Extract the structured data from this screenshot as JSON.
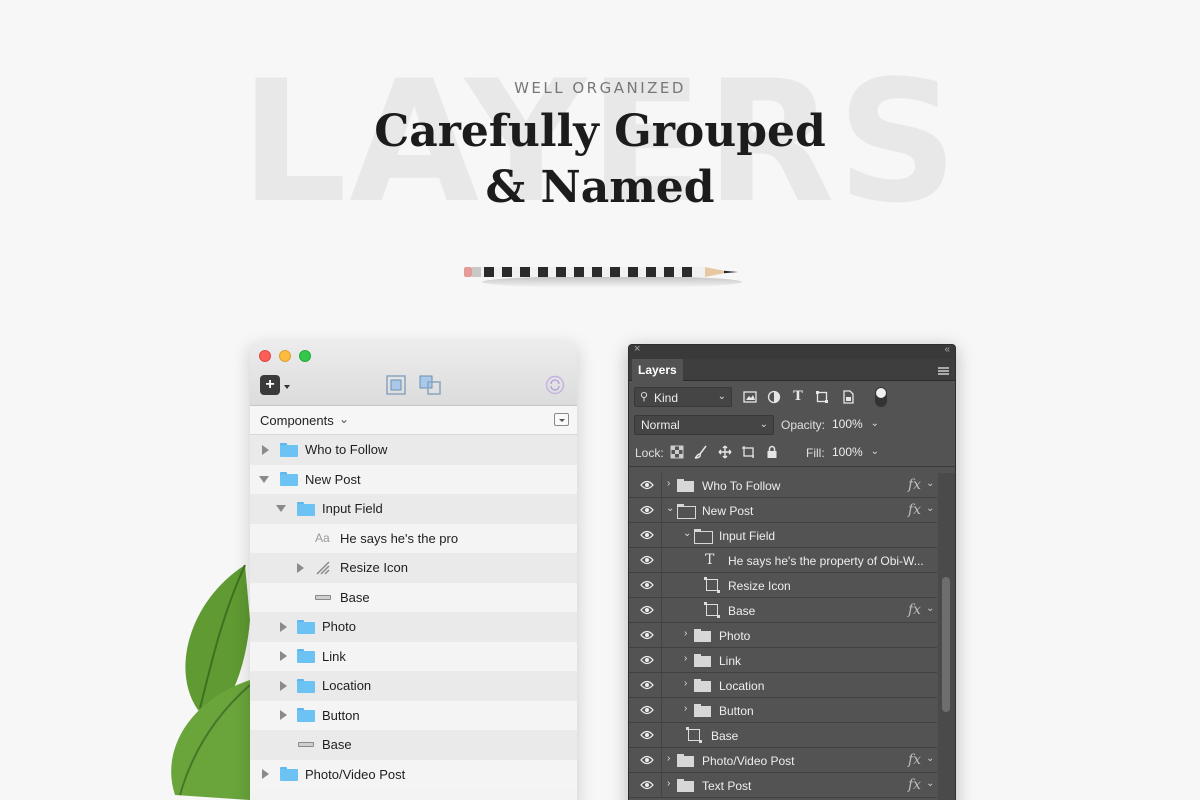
{
  "hero": {
    "background_word": "LAYERS",
    "eyebrow": "WELL ORGANIZED",
    "headline_line1": "Carefully Grouped",
    "headline_line2": "& Named"
  },
  "colors": {
    "background": "#f7f7f7",
    "sketch_folder": "#6cc3f3",
    "ps_panel": "#535353",
    "traffic_red": "#fc5f58",
    "traffic_yellow": "#fdbc40",
    "traffic_green": "#34c84a"
  },
  "sketch": {
    "toolbar": {
      "add_icon": "plus-icon",
      "tool1_icon": "group-icon",
      "tool2_icon": "ungroup-icon",
      "sync_icon": "sync-icon"
    },
    "page_selector": "Components",
    "layers": [
      {
        "label": "Who to Follow",
        "type": "folder",
        "state": "collapsed"
      },
      {
        "label": "New Post",
        "type": "folder",
        "state": "expanded"
      },
      {
        "label": "Input Field",
        "type": "folder",
        "state": "expanded"
      },
      {
        "label": "He says he's the pro",
        "type": "text",
        "icon_text": "Aa"
      },
      {
        "label": "Resize Icon",
        "type": "shape",
        "state": "collapsed"
      },
      {
        "label": "Base",
        "type": "rect"
      },
      {
        "label": "Photo",
        "type": "folder",
        "state": "collapsed"
      },
      {
        "label": "Link",
        "type": "folder",
        "state": "collapsed"
      },
      {
        "label": "Location",
        "type": "folder",
        "state": "collapsed"
      },
      {
        "label": "Button",
        "type": "folder",
        "state": "collapsed"
      },
      {
        "label": "Base",
        "type": "rect"
      },
      {
        "label": "Photo/Video Post",
        "type": "folder",
        "state": "collapsed"
      }
    ]
  },
  "photoshop": {
    "tab": "Layers",
    "filter_kind": "Kind",
    "blend_mode": "Normal",
    "opacity_label": "Opacity:",
    "opacity_value": "100%",
    "lock_label": "Lock:",
    "fill_label": "Fill:",
    "fill_value": "100%",
    "type_glyph": "T",
    "fx_glyph": "fx",
    "layers": [
      {
        "name": "Who To Follow",
        "kind": "folder",
        "fx": true
      },
      {
        "name": "New Post",
        "kind": "folder-open",
        "fx": true
      },
      {
        "name": "Input Field",
        "kind": "folder-open",
        "fx": false
      },
      {
        "name": "He says he's the property of Obi-W...",
        "kind": "text",
        "fx": false
      },
      {
        "name": "Resize Icon",
        "kind": "shape",
        "fx": false
      },
      {
        "name": "Base",
        "kind": "shape",
        "fx": true
      },
      {
        "name": "Photo",
        "kind": "folder",
        "fx": false
      },
      {
        "name": "Link",
        "kind": "folder",
        "fx": false
      },
      {
        "name": "Location",
        "kind": "folder",
        "fx": false
      },
      {
        "name": "Button",
        "kind": "folder",
        "fx": false
      },
      {
        "name": "Base",
        "kind": "shape",
        "fx": false
      },
      {
        "name": "Photo/Video Post",
        "kind": "folder",
        "fx": true
      },
      {
        "name": "Text Post",
        "kind": "folder",
        "fx": true
      }
    ]
  }
}
